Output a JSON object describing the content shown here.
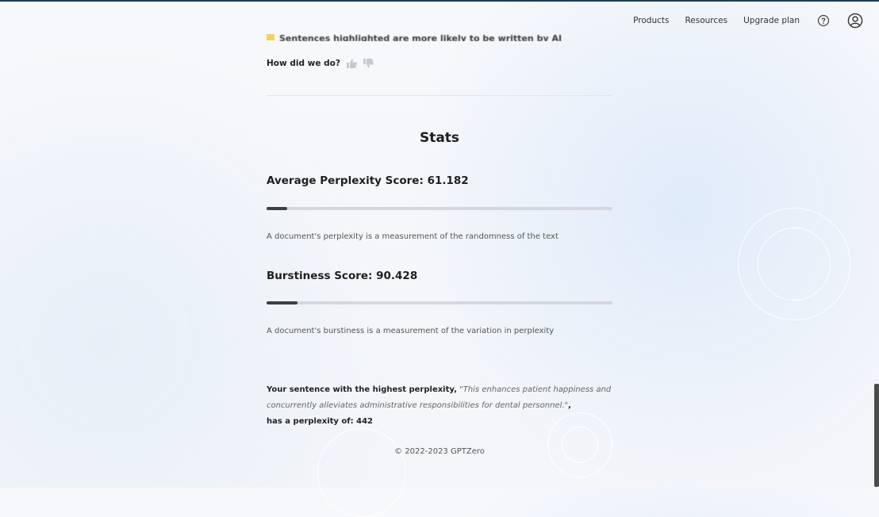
{
  "nav": {
    "products": "Products",
    "resources": "Resources",
    "upgrade": "Upgrade plan"
  },
  "banner": {
    "text": "Sentences highlighted are more likely to be written by AI",
    "highlight_color": "#f4d35a"
  },
  "feedback": {
    "label": "How did we do?"
  },
  "stats": {
    "title": "Stats",
    "perplexity": {
      "title": "Average Perplexity Score: 61.182",
      "progress": 0.06,
      "description": "A document's perplexity is a measurement of the randomness of the text"
    },
    "burstiness": {
      "title": "Burstiness Score: 90.428",
      "progress": 0.09,
      "description": "A document's burstiness is a measurement of the variation in perplexity"
    }
  },
  "highest": {
    "lead": "Your sentence with the highest perplexity,",
    "quote": "\"This enhances patient happiness and concurrently alleviates administrative responsibilities for dental personnel.\"",
    "comma": ",",
    "tail": "has a perplexity of: 442"
  },
  "footer": {
    "copyright": "© 2022-2023 GPTZero"
  },
  "colors": {
    "bar_track": "#d5d7dd",
    "bar_fill": "#3a3f4a",
    "top_rule": "#1c3d5a"
  }
}
